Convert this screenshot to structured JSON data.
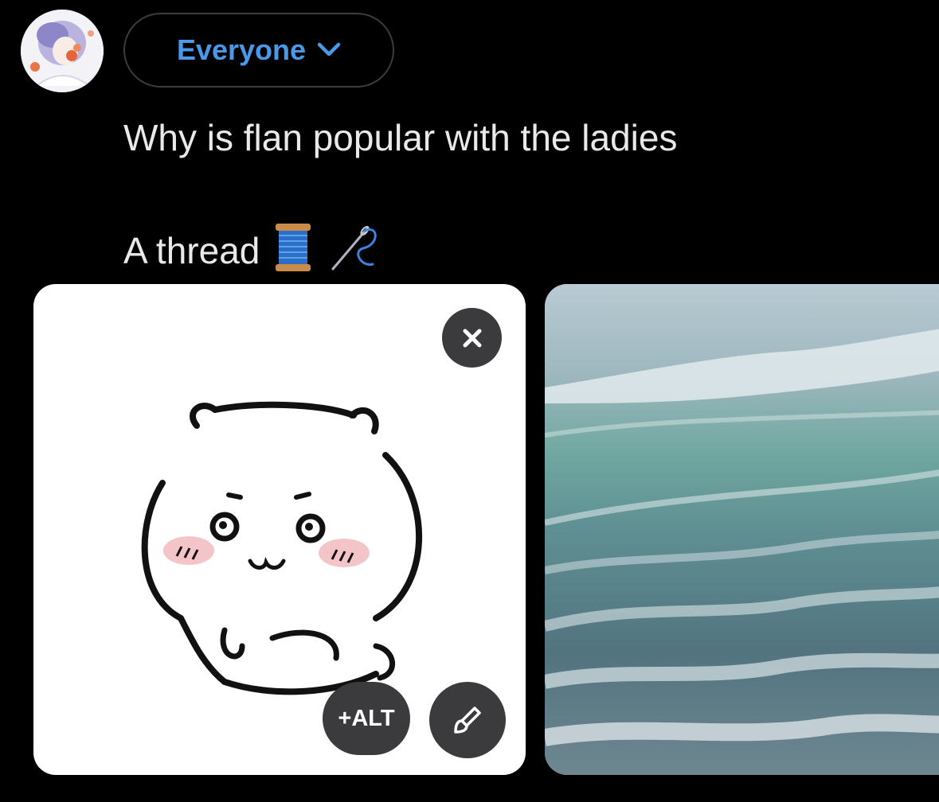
{
  "audience": {
    "label": "Everyone",
    "accent_color": "#4a99e9",
    "icon": "chevron-down-icon"
  },
  "post": {
    "line1": "Why is flan popular with the ladies",
    "line2": "A thread",
    "emojis": [
      "spool-of-thread-emoji",
      "needle-emoji"
    ]
  },
  "media": {
    "attachments": [
      {
        "subject": "white bear character illustration",
        "alt_label": "+ALT",
        "remove_icon": "close-icon",
        "edit_icon": "brush-icon"
      },
      {
        "subject": "ocean waves photo"
      }
    ]
  }
}
